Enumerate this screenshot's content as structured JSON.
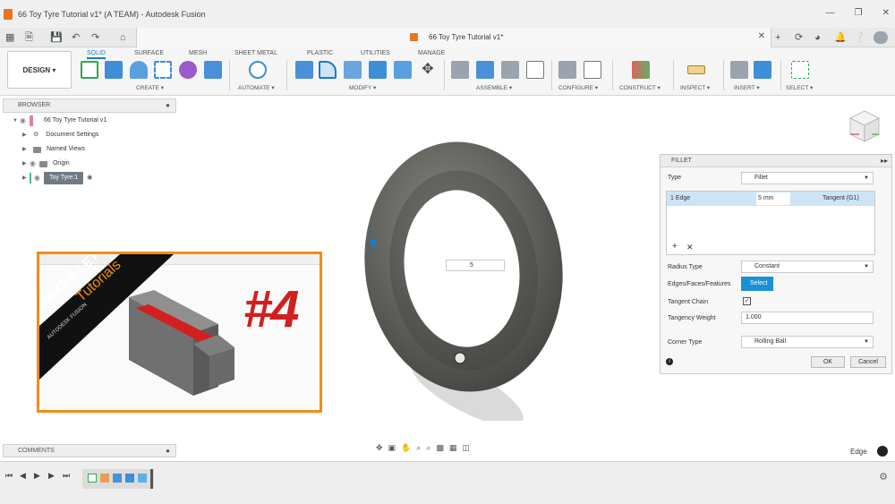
{
  "window": {
    "title": "66 Toy Tyre Tutorial v1* (A TEAM) - Autodesk Fusion"
  },
  "doc_tab": {
    "label": "66 Toy Tyre Tutorial v1*"
  },
  "ribbon": {
    "design_label": "DESIGN ▾",
    "tabs": [
      "SOLID",
      "SURFACE",
      "MESH",
      "SHEET METAL",
      "PLASTIC",
      "UTILITIES",
      "MANAGE"
    ],
    "groups": [
      "CREATE ▾",
      "AUTOMATE ▾",
      "MODIFY ▾",
      "ASSEMBLE ▾",
      "CONFIGURE ▾",
      "CONSTRUCT ▾",
      "INSPECT ▾",
      "INSERT ▾",
      "SELECT ▾"
    ]
  },
  "browser": {
    "title": "BROWSER",
    "items": [
      {
        "label": "66 Toy Tyre Tutorial v1"
      },
      {
        "label": "Document Settings"
      },
      {
        "label": "Named Views"
      },
      {
        "label": "Origin"
      },
      {
        "label": "Toy Tyre:1"
      }
    ]
  },
  "thumbnail": {
    "banner_line1": "MAKER LETT",
    "banner_line2": "Tutorials",
    "banner_line3": "AUTODESK FUSION",
    "big_number": "#4"
  },
  "viewport": {
    "inline_value": "5"
  },
  "fillet": {
    "title": "FILLET",
    "type_label": "Type",
    "type_value": "Fillet",
    "edge_label": "1 Edge",
    "edge_radius": "5 mm",
    "edge_tangent": "Tangent (G1)",
    "radius_type_label": "Radius Type",
    "radius_type_value": "Constant",
    "edges_label": "Edges/Faces/Features",
    "select_label": "Select",
    "tangent_chain_label": "Tangent Chain",
    "tangency_weight_label": "Tangency Weight",
    "tangency_weight_value": "1.000",
    "corner_type_label": "Corner Type",
    "corner_type_value": "Rolling Ball",
    "ok_label": "OK",
    "cancel_label": "Cancel"
  },
  "comments": {
    "title": "COMMENTS"
  },
  "status": {
    "edge_label": "Edge"
  }
}
